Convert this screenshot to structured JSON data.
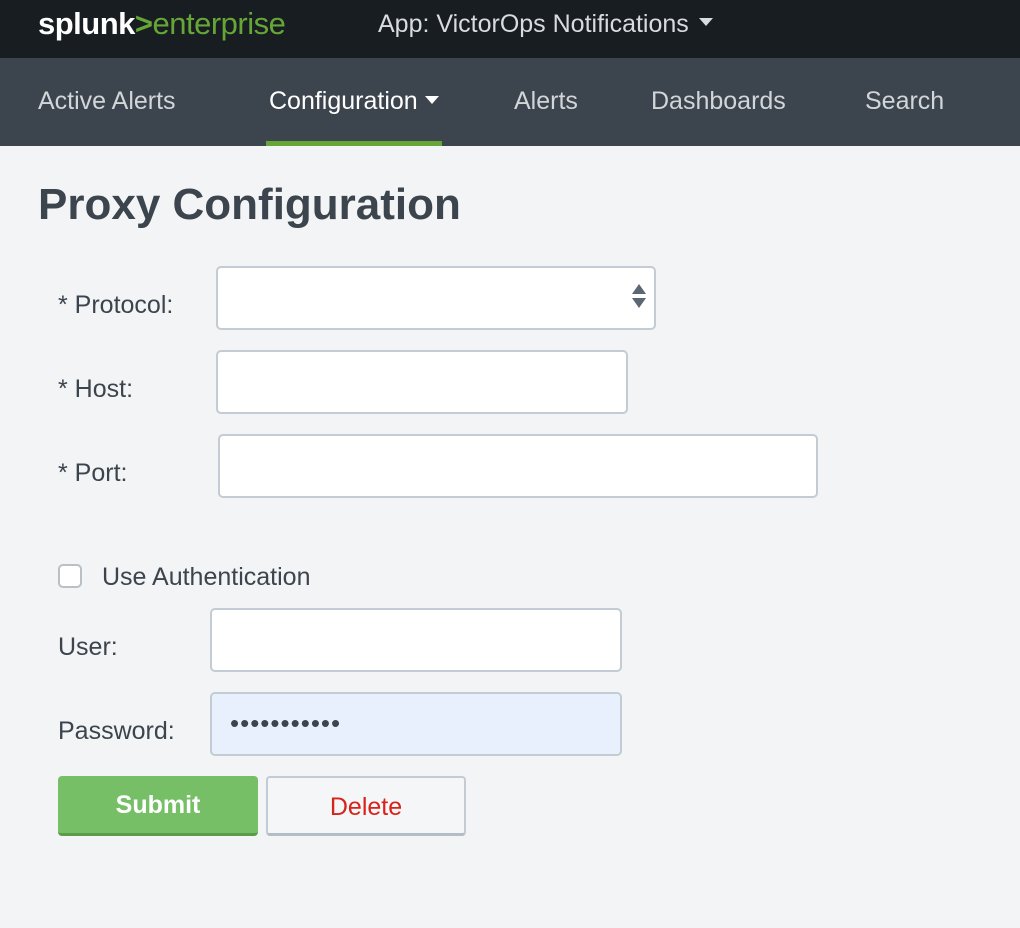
{
  "header": {
    "logo": {
      "prefix": "splunk",
      "separator": ">",
      "suffix": "enterprise"
    },
    "app_selector": "App: VictorOps Notifications"
  },
  "nav": {
    "items": [
      {
        "label": "Active Alerts"
      },
      {
        "label": "Configuration",
        "active": true,
        "dropdown": true
      },
      {
        "label": "Alerts"
      },
      {
        "label": "Dashboards"
      },
      {
        "label": "Search"
      }
    ]
  },
  "page": {
    "title": "Proxy Configuration"
  },
  "form": {
    "protocol": {
      "label": "* Protocol:",
      "value": ""
    },
    "host": {
      "label": "* Host:",
      "value": ""
    },
    "port": {
      "label": "* Port:",
      "value": ""
    },
    "use_auth": {
      "label": "Use Authentication",
      "checked": false
    },
    "user": {
      "label": "User:",
      "value": ""
    },
    "password": {
      "label": "Password:",
      "value": "•••••••••••"
    },
    "submit_label": "Submit",
    "delete_label": "Delete"
  },
  "colors": {
    "topbar_bg": "#171d21",
    "navbar_bg": "#3c444d",
    "brand_green": "#65a637",
    "submit_green": "#76bf66",
    "delete_red": "#d6231b",
    "autofill_bg": "#e8f0fe"
  }
}
